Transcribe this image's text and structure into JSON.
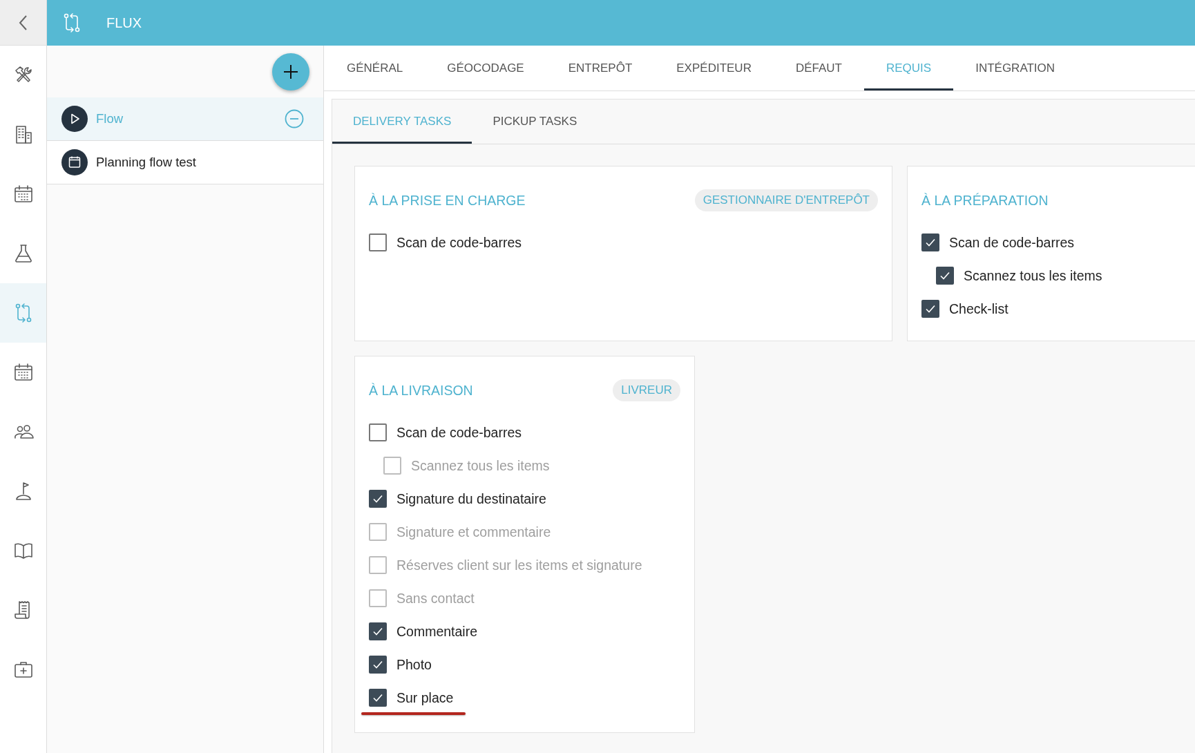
{
  "rail": {
    "items": [
      {
        "kind": "tools",
        "selected": false
      },
      {
        "kind": "building",
        "selected": false
      },
      {
        "kind": "calendar",
        "selected": false
      },
      {
        "kind": "flask",
        "selected": false
      },
      {
        "kind": "flow",
        "selected": true
      },
      {
        "kind": "calendar",
        "selected": false
      },
      {
        "kind": "people",
        "selected": false
      },
      {
        "kind": "flag",
        "selected": false
      },
      {
        "kind": "book",
        "selected": false
      },
      {
        "kind": "receipt",
        "selected": false
      },
      {
        "kind": "kit",
        "selected": false
      }
    ]
  },
  "header": {
    "title": "FLUX"
  },
  "flows": {
    "items": [
      {
        "label": "Flow",
        "kind": "play",
        "selected": true
      },
      {
        "label": "Planning flow test",
        "kind": "calendar",
        "selected": false
      }
    ]
  },
  "tabs": [
    {
      "label": "GÉNÉRAL",
      "selected": false
    },
    {
      "label": "GÉOCODAGE",
      "selected": false
    },
    {
      "label": "ENTREPÔT",
      "selected": false
    },
    {
      "label": "EXPÉDITEUR",
      "selected": false
    },
    {
      "label": "DÉFAUT",
      "selected": false
    },
    {
      "label": "REQUIS",
      "selected": true
    },
    {
      "label": "INTÉGRATION",
      "selected": false
    }
  ],
  "subtabs": [
    {
      "label": "DELIVERY TASKS",
      "selected": true
    },
    {
      "label": "PICKUP TASKS",
      "selected": false
    }
  ],
  "sections": [
    {
      "title": "À LA PRISE EN CHARGE",
      "badge": "GESTIONNAIRE D'ENTREPÔT",
      "options": [
        {
          "label": "Scan de code-barres",
          "checked": false,
          "disabled": false,
          "underlined": false
        }
      ]
    },
    {
      "title": "À LA PRÉPARATION",
      "options": [
        {
          "label": "Scan de code-barres",
          "checked": true,
          "disabled": false,
          "underlined": false,
          "children": [
            {
              "label": "Scannez tous les items",
              "checked": true,
              "disabled": false,
              "underlined": false
            }
          ]
        },
        {
          "label": "Check-list",
          "checked": true,
          "disabled": false,
          "underlined": false
        }
      ]
    },
    {
      "title": "À LA LIVRAISON",
      "badge": "LIVREUR",
      "options": [
        {
          "label": "Scan de code-barres",
          "checked": false,
          "disabled": false,
          "underlined": false,
          "children": [
            {
              "label": "Scannez tous les items",
              "checked": false,
              "disabled": true,
              "underlined": false
            }
          ]
        },
        {
          "label": "Signature du destinataire",
          "checked": true,
          "disabled": false,
          "underlined": false
        },
        {
          "label": "Signature et commentaire",
          "checked": false,
          "disabled": true,
          "underlined": false
        },
        {
          "label": "Réserves client sur les items et signature",
          "checked": false,
          "disabled": true,
          "underlined": false
        },
        {
          "label": "Sans contact",
          "checked": false,
          "disabled": true,
          "underlined": false
        },
        {
          "label": "Commentaire",
          "checked": true,
          "disabled": false,
          "underlined": false
        },
        {
          "label": "Photo",
          "checked": true,
          "disabled": false,
          "underlined": false
        },
        {
          "label": "Sur place",
          "checked": true,
          "disabled": false,
          "underlined": true
        }
      ]
    }
  ]
}
